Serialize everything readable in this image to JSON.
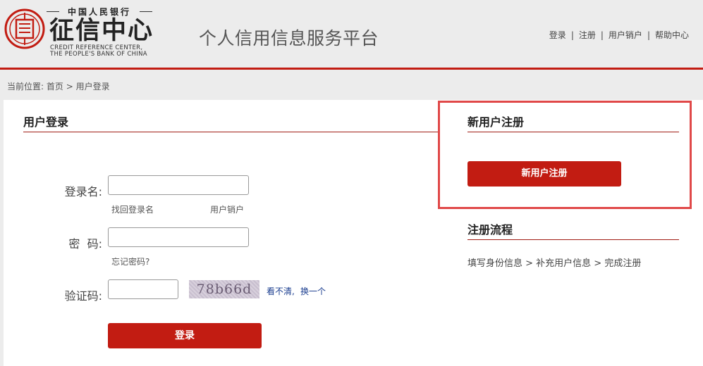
{
  "logo": {
    "seal_glyph": "信",
    "org": "中国人民银行",
    "name": "征信中心",
    "en_line1": "CREDIT REFERENCE CENTER,",
    "en_line2": "THE PEOPLE'S BANK OF CHINA"
  },
  "site_title": "个人信用信息服务平台",
  "top_nav": {
    "login": "登录",
    "register": "注册",
    "cancel_account": "用户销户",
    "help": "帮助中心",
    "separator": "|"
  },
  "breadcrumb": {
    "prefix": "当前位置:",
    "home": "首页",
    "arrow": ">",
    "current": "用户登录"
  },
  "login": {
    "title": "用户登录",
    "username_label": "登录名:",
    "username_value": "",
    "retrieve_username": "找回登录名",
    "cancel_account": "用户销户",
    "password_label": "密  码:",
    "password_value": "",
    "forgot_password": "忘记密码?",
    "captcha_label": "验证码:",
    "captcha_value": "",
    "captcha_image_text": "78b66d",
    "captcha_unclear": "看不清,",
    "captcha_refresh": "换一个",
    "submit": "登录"
  },
  "register": {
    "title": "新用户注册",
    "button": "新用户注册"
  },
  "flow": {
    "title": "注册流程",
    "steps": "填写身份信息 > 补充用户信息 > 完成注册"
  },
  "colors": {
    "brand_red": "#c21c12",
    "highlight": "#e04848",
    "link_blue": "#1a3d8f"
  }
}
